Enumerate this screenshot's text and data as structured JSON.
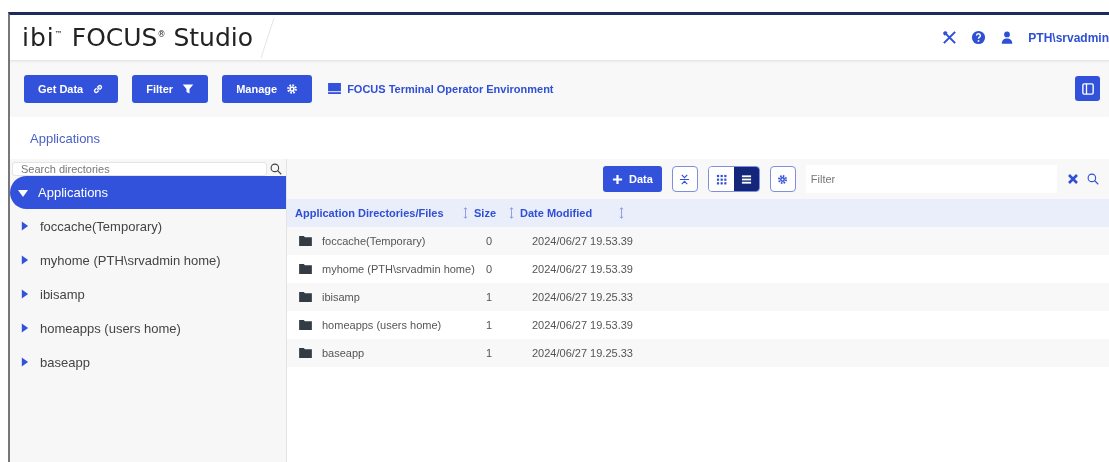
{
  "header": {
    "logo": "ibi$^{™}$",
    "product": "FOCUS$^{®}$ Studio",
    "user": "PTH\\srvadmin"
  },
  "toolbar": {
    "buttons": [
      {
        "label": "Get Data",
        "kind": "link"
      },
      {
        "label": "Filter",
        "kind": "filter"
      },
      {
        "label": "Manage",
        "kind": "gear"
      }
    ],
    "environment": "FOCUS Terminal Operator Environment"
  },
  "breadcrumb": "Applications",
  "sidebar": {
    "search": {
      "placeholder": "Search directories"
    },
    "tree": [
      {
        "label": "Applications",
        "expanded": true,
        "selected": true,
        "children": [
          {
            "label": "foccache(Temporary)",
            "expanded": false,
            "selected": false
          },
          {
            "label": "myhome (PTH\\srvadmin home)",
            "expanded": false,
            "selected": false
          },
          {
            "label": "ibisamp",
            "expanded": false,
            "selected": false
          },
          {
            "label": "homeapps (users home)",
            "expanded": false,
            "selected": false
          },
          {
            "label": "baseapp",
            "expanded": false,
            "selected": false
          }
        ]
      }
    ]
  },
  "content": {
    "add_button": "Data",
    "views": [
      {
        "kind": "grid",
        "selected": false
      },
      {
        "kind": "list",
        "selected": true
      }
    ],
    "filter": {
      "placeholder": "Filter"
    },
    "table": {
      "columns": [
        "Application Directories/Files",
        "Size",
        "Date Modified"
      ],
      "rows": [
        {
          "name": "foccache(Temporary)",
          "size": "0",
          "modified": "2024/06/27 19.53.39"
        },
        {
          "name": "myhome (PTH\\srvadmin home)",
          "size": "0",
          "modified": "2024/06/27 19.53.39"
        },
        {
          "name": "ibisamp",
          "size": "1",
          "modified": "2024/06/27 19.25.33"
        },
        {
          "name": "homeapps (users home)",
          "size": "1",
          "modified": "2024/06/27 19.53.39"
        },
        {
          "name": "baseapp",
          "size": "1",
          "modified": "2024/06/27 19.25.33"
        }
      ]
    }
  }
}
